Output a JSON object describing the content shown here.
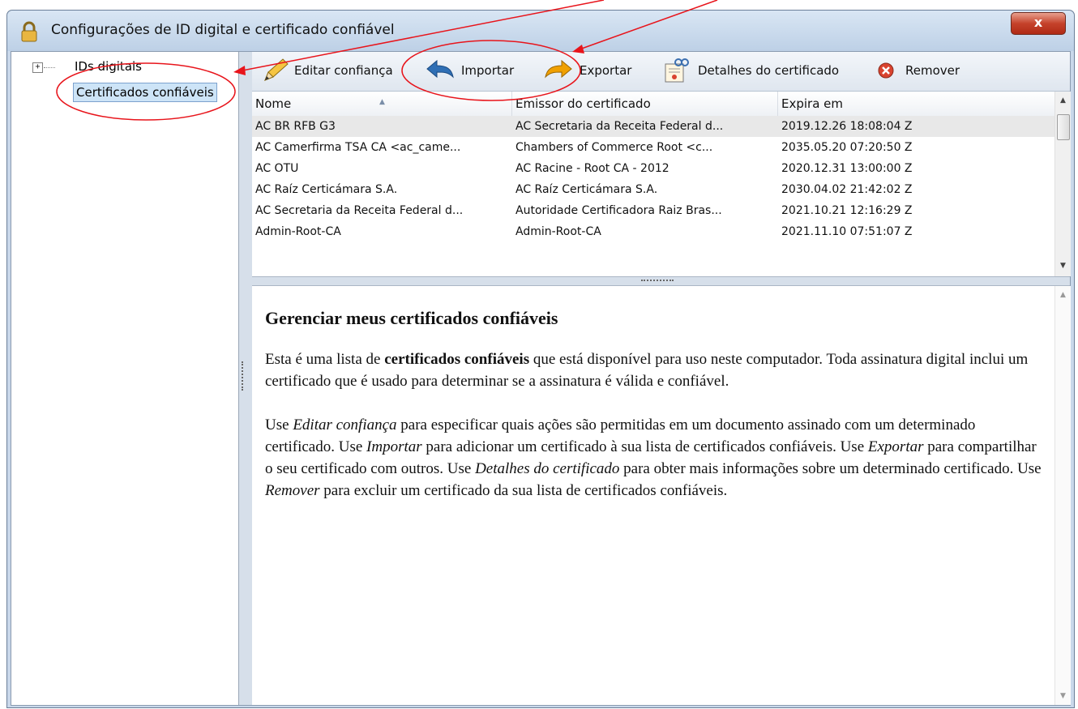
{
  "window": {
    "title": "Configurações de ID digital e certificado confiável",
    "close_glyph": "x",
    "icon": "lock-icon"
  },
  "tree": {
    "expander": "+",
    "items": [
      {
        "label": "IDs digitais"
      },
      {
        "label": "Certificados confiáveis",
        "selected": true
      }
    ]
  },
  "toolbar": {
    "edit_trust": "Editar confiança",
    "import": "Importar",
    "export": "Exportar",
    "cert_details": "Detalhes do certificado",
    "remove": "Remover"
  },
  "table": {
    "columns": [
      "Nome",
      "Emissor do certificado",
      "Expira em"
    ],
    "sort_column": "Nome",
    "rows": [
      [
        "AC BR RFB G3",
        "AC Secretaria da Receita Federal d...",
        "2019.12.26 18:08:04 Z"
      ],
      [
        "AC Camerfirma TSA CA <ac_came...",
        "Chambers of Commerce Root <c...",
        "2035.05.20 07:20:50 Z"
      ],
      [
        "AC OTU",
        "AC Racine - Root CA - 2012",
        "2020.12.31 13:00:00 Z"
      ],
      [
        "AC Raíz Certicámara S.A.",
        "AC Raíz Certicámara S.A.",
        "2030.04.02 21:42:02 Z"
      ],
      [
        "AC Secretaria da Receita Federal d...",
        "Autoridade Certificadora Raiz Bras...",
        "2021.10.21 12:16:29 Z"
      ],
      [
        "Admin-Root-CA",
        "Admin-Root-CA",
        "2021.11.10 07:51:07 Z"
      ]
    ],
    "selected_row": 0
  },
  "description": {
    "title": "Gerenciar meus certificados confiáveis",
    "p1_a": "Esta é uma lista de ",
    "p1_b": "certificados confiáveis",
    "p1_c": " que está disponível para uso neste computador. Toda assinatura digital inclui um certificado que é usado para determinar se a assinatura é válida e confiável.",
    "p2_a": "Use ",
    "p2_b": "Editar confiança",
    "p2_c": " para especificar quais ações são permitidas em um documento assinado com um determinado certificado. Use ",
    "p2_d": "Importar",
    "p2_e": " para adicionar um certificado à sua lista de certificados confiáveis. Use ",
    "p2_f": "Exportar",
    "p2_g": " para compartilhar o seu certificado com outros. Use ",
    "p2_h": "Detalhes do certificado",
    "p2_i": " para obter mais informações sobre um determinado certificado. Use ",
    "p2_j": "Remover",
    "p2_k": " para excluir um certificado da sua lista de certificados confiáveis."
  },
  "colors": {
    "annotation": "#e8141b",
    "selection": "#cde4f7",
    "import_arrow": "#2f6fb5",
    "export_arrow": "#f0a000",
    "remove_icon": "#d9432f"
  }
}
